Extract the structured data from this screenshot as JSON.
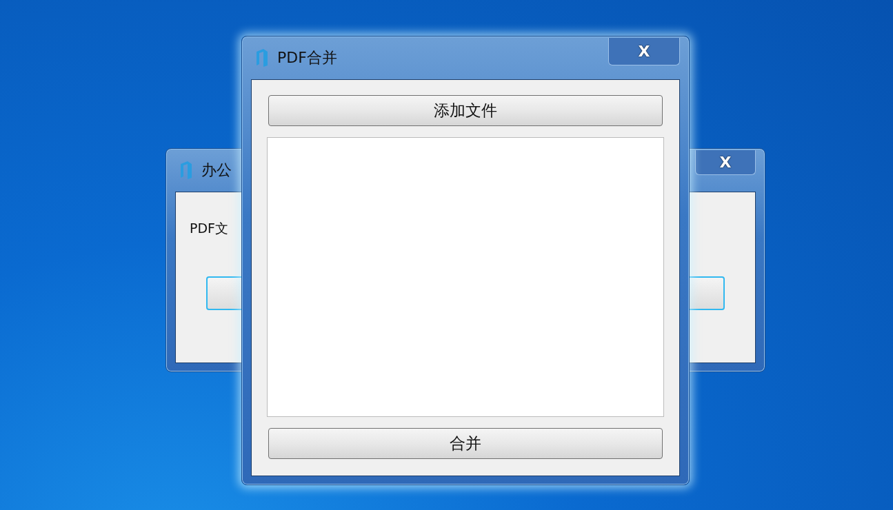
{
  "background_window": {
    "title": "办公",
    "close": "X",
    "label": "PDF文",
    "button": {
      "focused": true
    }
  },
  "main_window": {
    "title": "PDF合并",
    "close": "X",
    "add_button": "添加文件",
    "merge_button": "合并"
  }
}
